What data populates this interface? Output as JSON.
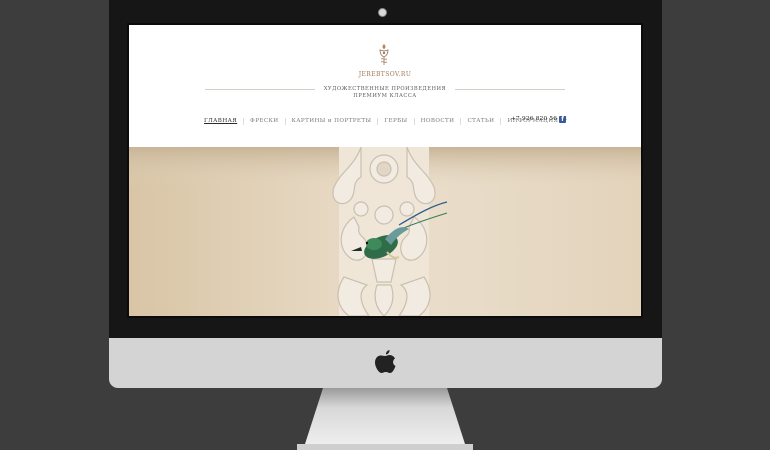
{
  "site": {
    "name": "JEREBTSOV.RU",
    "tagline_line1": "ХУДОЖЕСТВЕННЫЕ ПРОИЗВЕДЕНИЯ",
    "tagline_line2": "ПРЕМИУМ КЛАССА"
  },
  "nav": {
    "items": [
      {
        "label": "ГЛАВНАЯ",
        "active": true
      },
      {
        "label": "ФРЕСКИ"
      },
      {
        "label": "КАРТИНЫ и ПОРТРЕТЫ"
      },
      {
        "label": "ГЕРБЫ"
      },
      {
        "label": "НОВОСТИ"
      },
      {
        "label": "СТАТЬИ"
      },
      {
        "label": "ИНФОРМАЦИЯ"
      }
    ],
    "phone": "+7 926 820 56 52",
    "social_icon": "facebook-icon"
  },
  "colors": {
    "background": "#3d3d3d",
    "bezel": "#161616",
    "chin": "#d4d4d4",
    "hero_wall": "#dcc9ad",
    "brand_gold": "#a07a5c",
    "facebook": "#3b5998"
  },
  "icons": {
    "camera": "camera-dot",
    "logo": "heraldic-crest-icon",
    "hardware_logo": "apple-logo-icon"
  }
}
